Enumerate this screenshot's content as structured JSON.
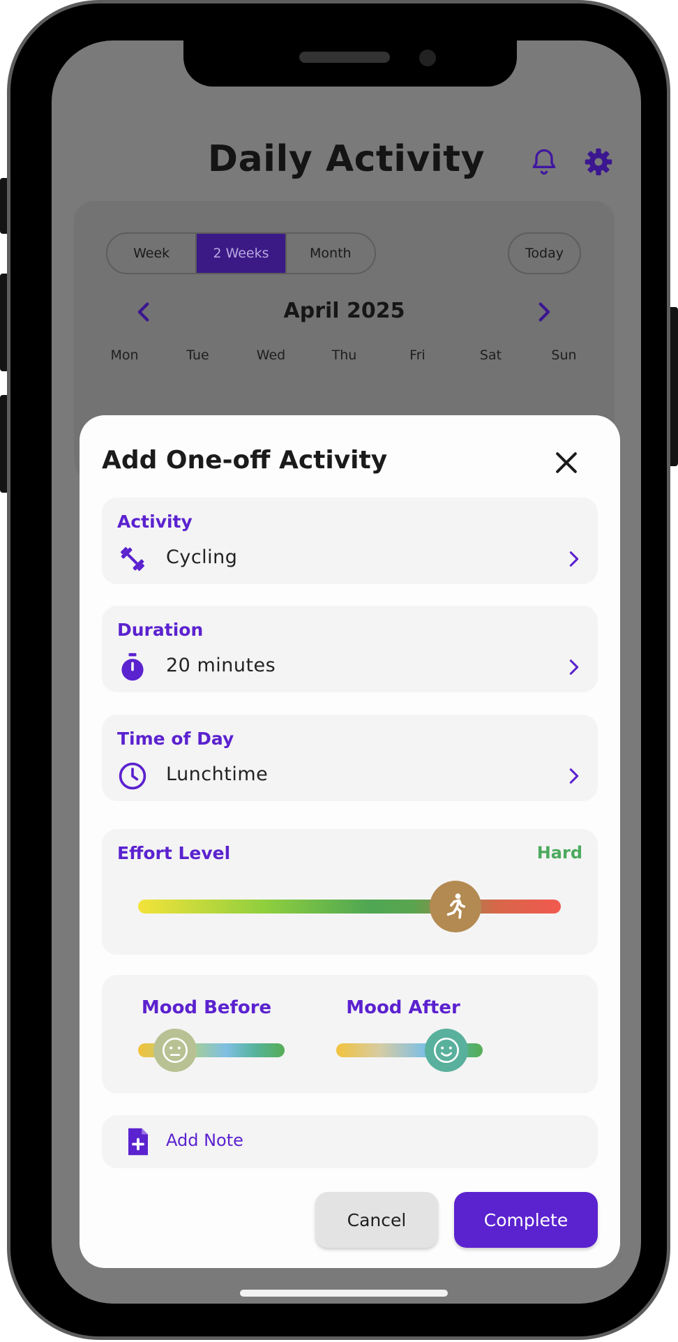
{
  "header": {
    "title": "Daily Activity",
    "bell_icon": "bell-icon",
    "settings_icon": "gear-icon"
  },
  "calendar": {
    "ranges": [
      "Week",
      "2 Weeks",
      "Month"
    ],
    "selected_range": "2 Weeks",
    "today_label": "Today",
    "month": "April 2025",
    "weekdays": [
      "Mon",
      "Tue",
      "Wed",
      "Thu",
      "Fri",
      "Sat",
      "Sun"
    ]
  },
  "sheet": {
    "title": "Add One-off Activity",
    "close_icon": "close-icon",
    "activity": {
      "label": "Activity",
      "value": "Cycling",
      "icon": "dumbbell-icon"
    },
    "duration": {
      "label": "Duration",
      "value": "20 minutes",
      "icon": "stopwatch-icon"
    },
    "time_of_day": {
      "label": "Time of Day",
      "value": "Lunchtime",
      "icon": "clock-icon"
    },
    "effort": {
      "label": "Effort Level",
      "value": "Hard",
      "level": 0.75,
      "icon": "running-person-icon"
    },
    "mood_before": {
      "label": "Mood Before",
      "level": 0.25,
      "icon": "neutral-face-icon"
    },
    "mood_after": {
      "label": "Mood After",
      "level": 0.75,
      "icon": "smiling-face-icon"
    },
    "note": {
      "label": "Add Note",
      "icon": "add-document-icon"
    },
    "cancel_label": "Cancel",
    "complete_label": "Complete"
  },
  "colors": {
    "accent": "#5b22cf",
    "effort_hard": "#4caa5e",
    "scrim": "#7a7a7a"
  }
}
